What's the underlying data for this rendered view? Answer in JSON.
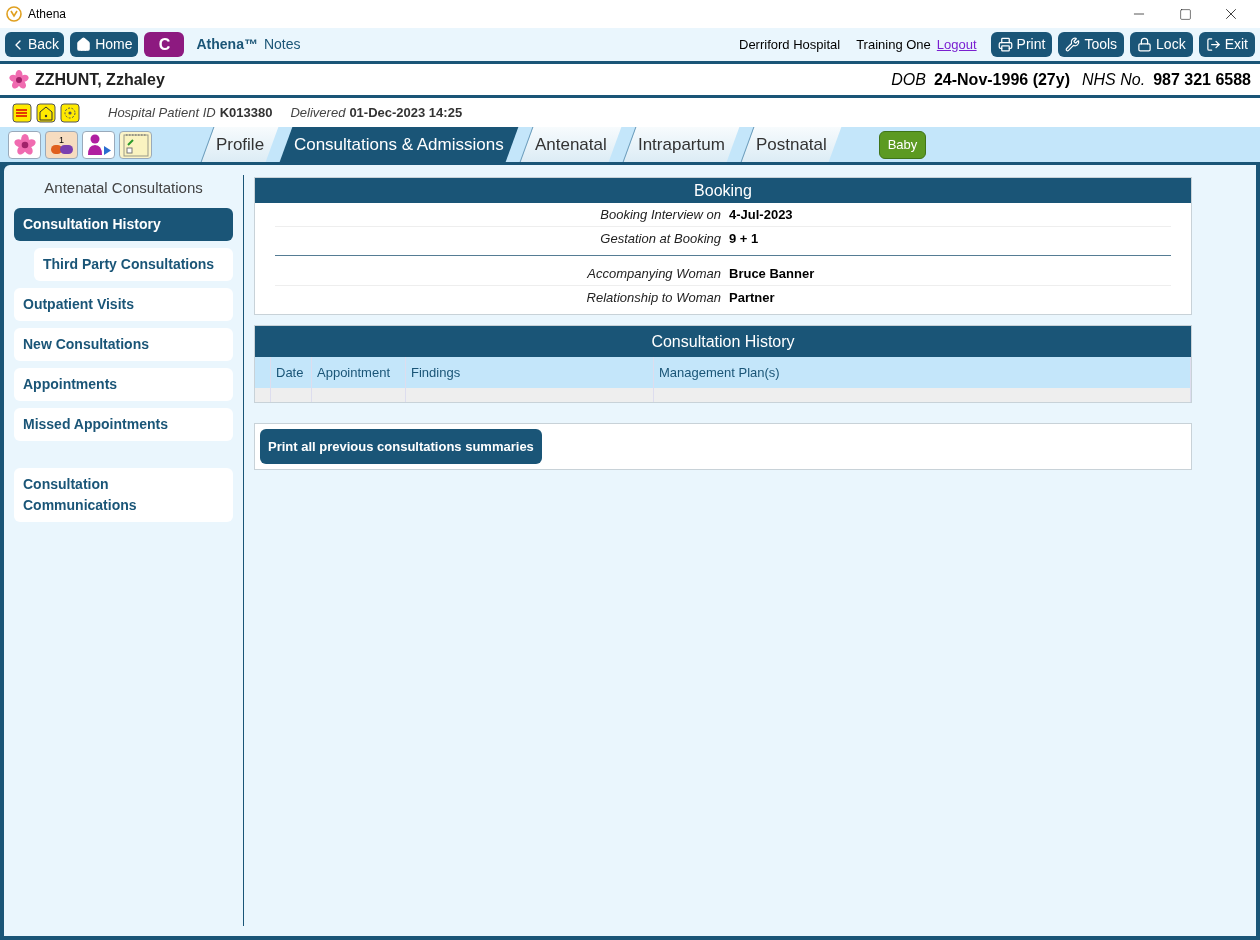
{
  "window": {
    "title": "Athena"
  },
  "toolbar": {
    "back": "Back",
    "home": "Home",
    "c_button": "C",
    "app_name": "Athena™",
    "app_subtitle": "Notes",
    "hospital": "Derriford Hospital",
    "user": "Training One",
    "logout": "Logout",
    "buttons": [
      {
        "kind": "print",
        "label": "Print"
      },
      {
        "kind": "tools",
        "label": "Tools"
      },
      {
        "kind": "lock",
        "label": "Lock"
      },
      {
        "kind": "exit",
        "label": "Exit"
      }
    ]
  },
  "patient": {
    "name": "ZZHUNT, Zzhaley",
    "dob_label": "DOB",
    "dob": "24-Nov-1996 (27y)",
    "nhs_label": "NHS No.",
    "nhs": "987 321 6588"
  },
  "patient_info": {
    "id_label": "Hospital Patient ID",
    "id": "K013380",
    "delivered_label": "Delivered",
    "delivered": "01-Dec-2023 14:25"
  },
  "quick_icons": [
    {
      "kind": "flower"
    },
    {
      "kind": "medication",
      "count": "1"
    },
    {
      "kind": "person"
    },
    {
      "kind": "notes"
    }
  ],
  "tabs": [
    {
      "label": "Profile",
      "selected": false
    },
    {
      "label": "Consultations & Admissions",
      "selected": true
    },
    {
      "label": "Antenatal",
      "selected": false
    },
    {
      "label": "Intrapartum",
      "selected": false
    },
    {
      "label": "Postnatal",
      "selected": false
    }
  ],
  "baby_button": "Baby",
  "sidebar": {
    "title": "Antenatal Consultations",
    "groups": [
      [
        {
          "label": "Consultation History",
          "selected": true,
          "children": [
            {
              "label": "Third Party Consultations",
              "selected": false
            }
          ]
        },
        {
          "label": "Outpatient Visits",
          "selected": false
        },
        {
          "label": "New Consultations",
          "selected": false
        },
        {
          "label": "Appointments",
          "selected": false
        },
        {
          "label": "Missed Appointments",
          "selected": false
        }
      ],
      [
        {
          "label": "Consultation Communications",
          "selected": false
        }
      ]
    ]
  },
  "booking": {
    "title": "Booking",
    "sections": [
      [
        {
          "label": "Booking Interview on",
          "value": "4-Jul-2023"
        },
        {
          "label": "Gestation at Booking",
          "value": "9 + 1"
        }
      ],
      [
        {
          "label": "Accompanying Woman",
          "value": "Bruce Banner"
        },
        {
          "label": "Relationship to Woman",
          "value": "Partner"
        }
      ]
    ]
  },
  "history": {
    "title": "Consultation History",
    "columns": [
      "Date",
      "Appointment",
      "Findings",
      "Management Plan(s)"
    ]
  },
  "print_button": "Print all previous consultations summaries"
}
